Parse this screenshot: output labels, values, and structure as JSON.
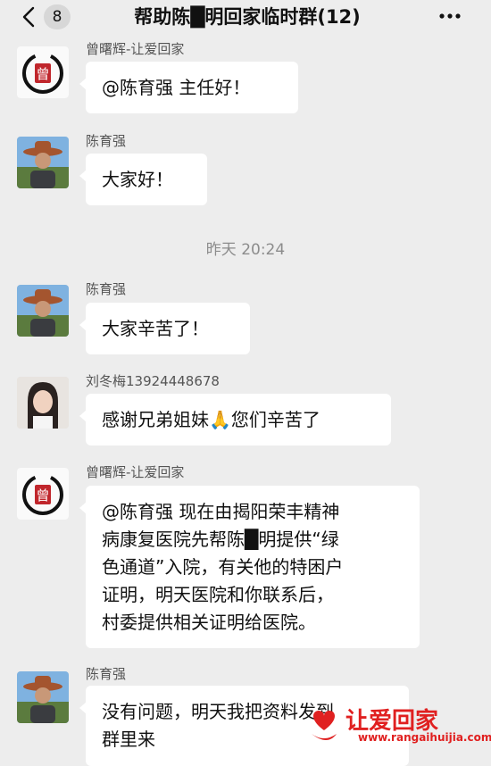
{
  "header": {
    "back_count": "8",
    "title": "帮助陈█明回家临时群(12)"
  },
  "icons": {
    "back": "chevron-left-icon",
    "more": "more-dots-icon"
  },
  "messages": [
    {
      "sender": "曾曙辉-让爱回家",
      "text": "@陈育强 主任好！"
    },
    {
      "sender": "陈育强",
      "text": "大家好！"
    },
    {
      "sender": "陈育强",
      "text": "大家辛苦了！"
    },
    {
      "sender": "刘冬梅13924448678",
      "text": "感谢兄弟姐妹🙏您们辛苦了"
    },
    {
      "sender": "曾曙辉-让爱回家",
      "text": "@陈育强 现在由揭阳荣丰精神\n病康复医院先帮陈█明提供“绿\n色通道”入院，有关他的特困户\n证明，明天医院和你联系后，\n村委提供相关证明给医院。"
    },
    {
      "sender": "陈育强",
      "text": "没有问题，明天我把资料发到\n群里来"
    }
  ],
  "timestamp": "昨天 20:24",
  "avatar_text": {
    "seal_char": "曾"
  },
  "watermark": {
    "title": "让爱回家",
    "url": "www.rangaihuijia.com"
  },
  "colors": {
    "background": "#ededed",
    "bubble": "#ffffff",
    "watermark_red": "#e02020"
  }
}
